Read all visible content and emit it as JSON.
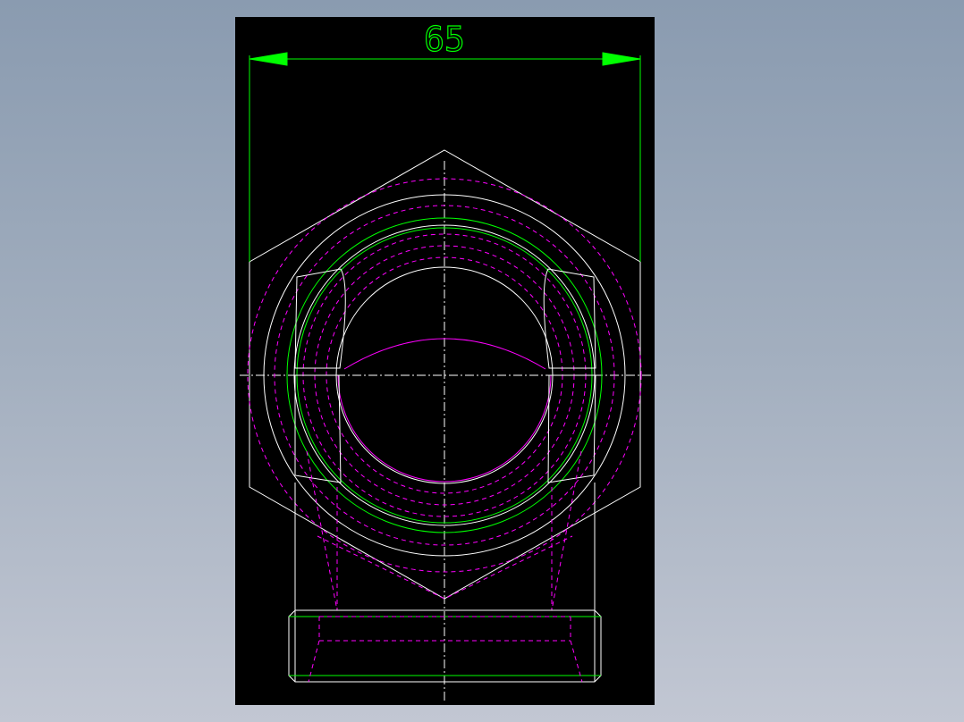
{
  "drawing": {
    "dimension_label": "65",
    "colors": {
      "background": "#000000",
      "visible_lines": "#ffffff",
      "hidden_lines": "#ff00ff",
      "dimension": "#00ff00",
      "thread": "#00ff00"
    }
  }
}
